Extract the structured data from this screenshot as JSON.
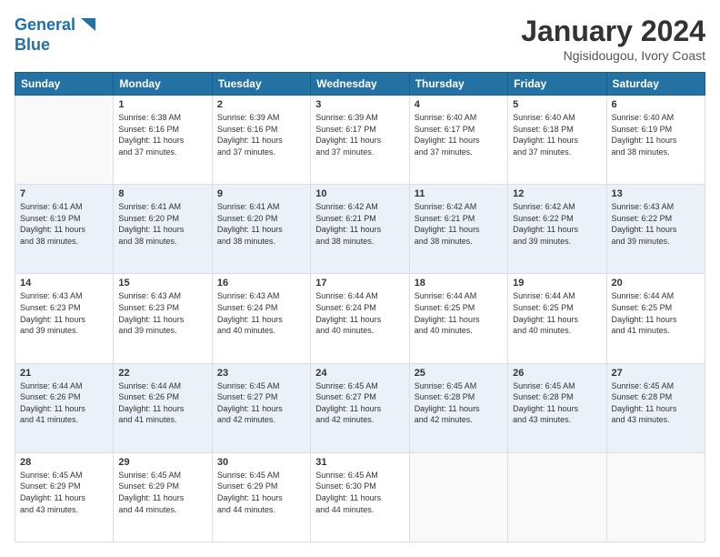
{
  "logo": {
    "line1": "General",
    "line2": "Blue"
  },
  "title": "January 2024",
  "subtitle": "Ngisidougou, Ivory Coast",
  "headers": [
    "Sunday",
    "Monday",
    "Tuesday",
    "Wednesday",
    "Thursday",
    "Friday",
    "Saturday"
  ],
  "weeks": [
    [
      {
        "day": "",
        "info": ""
      },
      {
        "day": "1",
        "info": "Sunrise: 6:38 AM\nSunset: 6:16 PM\nDaylight: 11 hours\nand 37 minutes."
      },
      {
        "day": "2",
        "info": "Sunrise: 6:39 AM\nSunset: 6:16 PM\nDaylight: 11 hours\nand 37 minutes."
      },
      {
        "day": "3",
        "info": "Sunrise: 6:39 AM\nSunset: 6:17 PM\nDaylight: 11 hours\nand 37 minutes."
      },
      {
        "day": "4",
        "info": "Sunrise: 6:40 AM\nSunset: 6:17 PM\nDaylight: 11 hours\nand 37 minutes."
      },
      {
        "day": "5",
        "info": "Sunrise: 6:40 AM\nSunset: 6:18 PM\nDaylight: 11 hours\nand 37 minutes."
      },
      {
        "day": "6",
        "info": "Sunrise: 6:40 AM\nSunset: 6:19 PM\nDaylight: 11 hours\nand 38 minutes."
      }
    ],
    [
      {
        "day": "7",
        "info": "Sunrise: 6:41 AM\nSunset: 6:19 PM\nDaylight: 11 hours\nand 38 minutes."
      },
      {
        "day": "8",
        "info": "Sunrise: 6:41 AM\nSunset: 6:20 PM\nDaylight: 11 hours\nand 38 minutes."
      },
      {
        "day": "9",
        "info": "Sunrise: 6:41 AM\nSunset: 6:20 PM\nDaylight: 11 hours\nand 38 minutes."
      },
      {
        "day": "10",
        "info": "Sunrise: 6:42 AM\nSunset: 6:21 PM\nDaylight: 11 hours\nand 38 minutes."
      },
      {
        "day": "11",
        "info": "Sunrise: 6:42 AM\nSunset: 6:21 PM\nDaylight: 11 hours\nand 38 minutes."
      },
      {
        "day": "12",
        "info": "Sunrise: 6:42 AM\nSunset: 6:22 PM\nDaylight: 11 hours\nand 39 minutes."
      },
      {
        "day": "13",
        "info": "Sunrise: 6:43 AM\nSunset: 6:22 PM\nDaylight: 11 hours\nand 39 minutes."
      }
    ],
    [
      {
        "day": "14",
        "info": "Sunrise: 6:43 AM\nSunset: 6:23 PM\nDaylight: 11 hours\nand 39 minutes."
      },
      {
        "day": "15",
        "info": "Sunrise: 6:43 AM\nSunset: 6:23 PM\nDaylight: 11 hours\nand 39 minutes."
      },
      {
        "day": "16",
        "info": "Sunrise: 6:43 AM\nSunset: 6:24 PM\nDaylight: 11 hours\nand 40 minutes."
      },
      {
        "day": "17",
        "info": "Sunrise: 6:44 AM\nSunset: 6:24 PM\nDaylight: 11 hours\nand 40 minutes."
      },
      {
        "day": "18",
        "info": "Sunrise: 6:44 AM\nSunset: 6:25 PM\nDaylight: 11 hours\nand 40 minutes."
      },
      {
        "day": "19",
        "info": "Sunrise: 6:44 AM\nSunset: 6:25 PM\nDaylight: 11 hours\nand 40 minutes."
      },
      {
        "day": "20",
        "info": "Sunrise: 6:44 AM\nSunset: 6:25 PM\nDaylight: 11 hours\nand 41 minutes."
      }
    ],
    [
      {
        "day": "21",
        "info": "Sunrise: 6:44 AM\nSunset: 6:26 PM\nDaylight: 11 hours\nand 41 minutes."
      },
      {
        "day": "22",
        "info": "Sunrise: 6:44 AM\nSunset: 6:26 PM\nDaylight: 11 hours\nand 41 minutes."
      },
      {
        "day": "23",
        "info": "Sunrise: 6:45 AM\nSunset: 6:27 PM\nDaylight: 11 hours\nand 42 minutes."
      },
      {
        "day": "24",
        "info": "Sunrise: 6:45 AM\nSunset: 6:27 PM\nDaylight: 11 hours\nand 42 minutes."
      },
      {
        "day": "25",
        "info": "Sunrise: 6:45 AM\nSunset: 6:28 PM\nDaylight: 11 hours\nand 42 minutes."
      },
      {
        "day": "26",
        "info": "Sunrise: 6:45 AM\nSunset: 6:28 PM\nDaylight: 11 hours\nand 43 minutes."
      },
      {
        "day": "27",
        "info": "Sunrise: 6:45 AM\nSunset: 6:28 PM\nDaylight: 11 hours\nand 43 minutes."
      }
    ],
    [
      {
        "day": "28",
        "info": "Sunrise: 6:45 AM\nSunset: 6:29 PM\nDaylight: 11 hours\nand 43 minutes."
      },
      {
        "day": "29",
        "info": "Sunrise: 6:45 AM\nSunset: 6:29 PM\nDaylight: 11 hours\nand 44 minutes."
      },
      {
        "day": "30",
        "info": "Sunrise: 6:45 AM\nSunset: 6:29 PM\nDaylight: 11 hours\nand 44 minutes."
      },
      {
        "day": "31",
        "info": "Sunrise: 6:45 AM\nSunset: 6:30 PM\nDaylight: 11 hours\nand 44 minutes."
      },
      {
        "day": "",
        "info": ""
      },
      {
        "day": "",
        "info": ""
      },
      {
        "day": "",
        "info": ""
      }
    ]
  ]
}
